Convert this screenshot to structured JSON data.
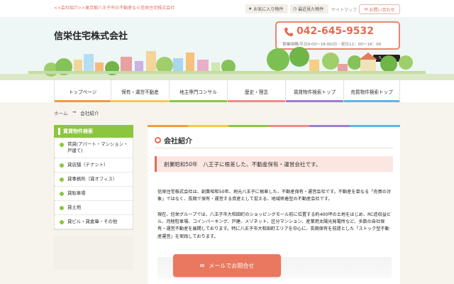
{
  "top": {
    "tagline": "<<会社紹介>>東京都八王子市の不動産なら信栄住宅株式会社",
    "favorites": "お気に入り物件",
    "recent": "最近見た物件",
    "sitemap": "サイトマップ",
    "contact": "お問い合わせ"
  },
  "header": {
    "company": "信栄住宅株式会社",
    "phone": "042-645-9532",
    "hours": "営業時間/平日9:00～18:00/日・祝日12：00～18：00",
    "post": "ポスト"
  },
  "nav": {
    "items": [
      "トップページ",
      "保有・運営不動産",
      "地主専門コンサル",
      "歴史・理念",
      "賃貸物件検索トップ",
      "売買物件検索トップ"
    ]
  },
  "breadcrumb": {
    "home": "ホーム",
    "sep": "→",
    "current": "会社紹介"
  },
  "sidebar": {
    "heading": "賃貸物件検索",
    "items": [
      "賃貸(アパート・マンション・戸建て)",
      "貸店舗（テナント）",
      "貸事務所（貸オフィス）",
      "貸駐車場",
      "貸土地",
      "貸ビル・貸倉庫・その他"
    ]
  },
  "main": {
    "title": "会社紹介",
    "catch": "創業昭和50年　八王子に根差した、不動産保有・運営会社です。",
    "para1": "信栄住宅株式会社は、創業昭和50年、地元八王子に根差した、不動産保有・運営会社です。不動産を単なる「売買の対象」ではなく、長期で保有・運営する資産として捉える、地域密着型の不動産会社です。",
    "para2": "現在、信栄グループでは、八王子市大和田町のショッピングモール前に位置する約400坪の土地をはじめ、RC造収益ビル、月極駐車場、コインパーキング、戸建、メゾネット、区分マンション、産業用太陽光発電所など、多数の自社保有・運営不動産を展開しております。特に八王子市大和田町エリアを中心に、長期保有を前提とした「ストック型不動産運営」を実践しております。"
  },
  "mail_button": "メールでお問合せ",
  "colors": {
    "accent": "#e9785f",
    "green": "#8cc63f"
  }
}
